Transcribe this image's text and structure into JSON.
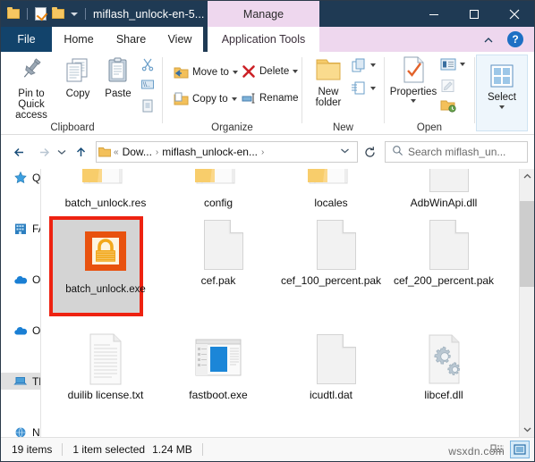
{
  "window": {
    "title": "miflash_unlock-en-5...",
    "contextual_tab": "Manage",
    "minimize": "Minimize",
    "maximize": "Maximize",
    "close": "Close"
  },
  "quick_access_toolbar": {
    "items": [
      {
        "name": "folder-icon",
        "label": "Open folder"
      },
      {
        "name": "properties-icon",
        "label": "Properties"
      },
      {
        "name": "new-folder-icon",
        "label": "New folder"
      },
      {
        "name": "chevron-down-icon",
        "label": "Customize Quick Access Toolbar"
      }
    ]
  },
  "tabs": [
    {
      "id": "file",
      "label": "File"
    },
    {
      "id": "home",
      "label": "Home"
    },
    {
      "id": "share",
      "label": "Share"
    },
    {
      "id": "view",
      "label": "View"
    },
    {
      "id": "apptools",
      "label": "Application Tools"
    }
  ],
  "ribbon": {
    "collapse_label": "Collapse the Ribbon",
    "help_label": "?",
    "groups": [
      {
        "name": "Clipboard",
        "buttons": [
          {
            "label": "Pin to Quick access"
          },
          {
            "label": "Copy"
          },
          {
            "label": "Paste"
          },
          {
            "label": "Cut"
          },
          {
            "label": "Copy path"
          },
          {
            "label": "Paste shortcut"
          }
        ]
      },
      {
        "name": "Organize",
        "buttons": [
          {
            "label": "Move to"
          },
          {
            "label": "Copy to"
          },
          {
            "label": "Delete"
          },
          {
            "label": "Rename"
          }
        ]
      },
      {
        "name": "New",
        "buttons": [
          {
            "label": "New folder"
          },
          {
            "label": "New item"
          },
          {
            "label": "Easy access"
          }
        ]
      },
      {
        "name": "Open",
        "buttons": [
          {
            "label": "Properties"
          },
          {
            "label": "Open"
          },
          {
            "label": "Edit"
          },
          {
            "label": "History"
          }
        ]
      },
      {
        "name": "",
        "buttons": [
          {
            "label": "Select"
          }
        ]
      }
    ]
  },
  "navigation": {
    "back": "Back",
    "forward": "Forward",
    "recent": "Recent locations",
    "up": "Up",
    "refresh": "Refresh",
    "breadcrumb": {
      "overflow": "«",
      "parts": [
        "Dow...",
        "miflash_unlock-en..."
      ]
    },
    "address_dropdown": "Previous locations"
  },
  "search": {
    "placeholder": "Search miflash_un...",
    "icon": "search-icon"
  },
  "nav_pane": {
    "items": [
      {
        "label": "Quick access",
        "icon": "star-icon",
        "selected": false
      },
      {
        "label": "FAST",
        "icon": "building-icon",
        "selected": false
      },
      {
        "label": "OneDrive",
        "icon": "cloud-icon",
        "selected": false
      },
      {
        "label": "OneDrive",
        "icon": "cloud-icon",
        "selected": false
      },
      {
        "label": "This PC",
        "icon": "computer-icon",
        "selected": true
      },
      {
        "label": "Network",
        "icon": "network-icon",
        "selected": false
      }
    ]
  },
  "files": [
    {
      "name": "batch_unlock.res",
      "icon": "folder-icon",
      "type": "folder",
      "selected": false,
      "row": 0,
      "col": 0
    },
    {
      "name": "config",
      "icon": "folder-icon",
      "type": "folder",
      "selected": false,
      "row": 0,
      "col": 1
    },
    {
      "name": "locales",
      "icon": "folder-icon",
      "type": "folder",
      "selected": false,
      "row": 0,
      "col": 2
    },
    {
      "name": "AdbWinApi.dll",
      "icon": "file-icon",
      "type": "file",
      "selected": false,
      "row": 0,
      "col": 3
    },
    {
      "name": "batch_unlock.exe",
      "icon": "lock-app-icon",
      "type": "application",
      "selected": true,
      "row": 1,
      "col": 0
    },
    {
      "name": "cef.pak",
      "icon": "file-icon",
      "type": "file",
      "selected": false,
      "row": 1,
      "col": 1
    },
    {
      "name": "cef_100_percent.pak",
      "icon": "file-icon",
      "type": "file",
      "selected": false,
      "row": 1,
      "col": 2
    },
    {
      "name": "cef_200_percent.pak",
      "icon": "file-icon",
      "type": "file",
      "selected": false,
      "row": 1,
      "col": 3
    },
    {
      "name": "duilib license.txt",
      "icon": "text-file-icon",
      "type": "file",
      "selected": false,
      "row": 2,
      "col": 0
    },
    {
      "name": "fastboot.exe",
      "icon": "window-app-icon",
      "type": "application",
      "selected": false,
      "row": 2,
      "col": 1
    },
    {
      "name": "icudtl.dat",
      "icon": "file-icon",
      "type": "file",
      "selected": false,
      "row": 2,
      "col": 2
    },
    {
      "name": "libcef.dll",
      "icon": "gears-file-icon",
      "type": "file",
      "selected": false,
      "row": 2,
      "col": 3
    }
  ],
  "status_bar": {
    "item_count": "19 items",
    "selection": "1 item selected",
    "selection_size": "1.24 MB",
    "view_details": "Details view",
    "view_large_icons": "Large icons view"
  },
  "watermark": "wsxdn.com",
  "colors": {
    "titlebar": "#1f3a54",
    "contextual_tab": "#eed7ee",
    "selection_outline": "#ee2211",
    "accent": "#12436b"
  }
}
